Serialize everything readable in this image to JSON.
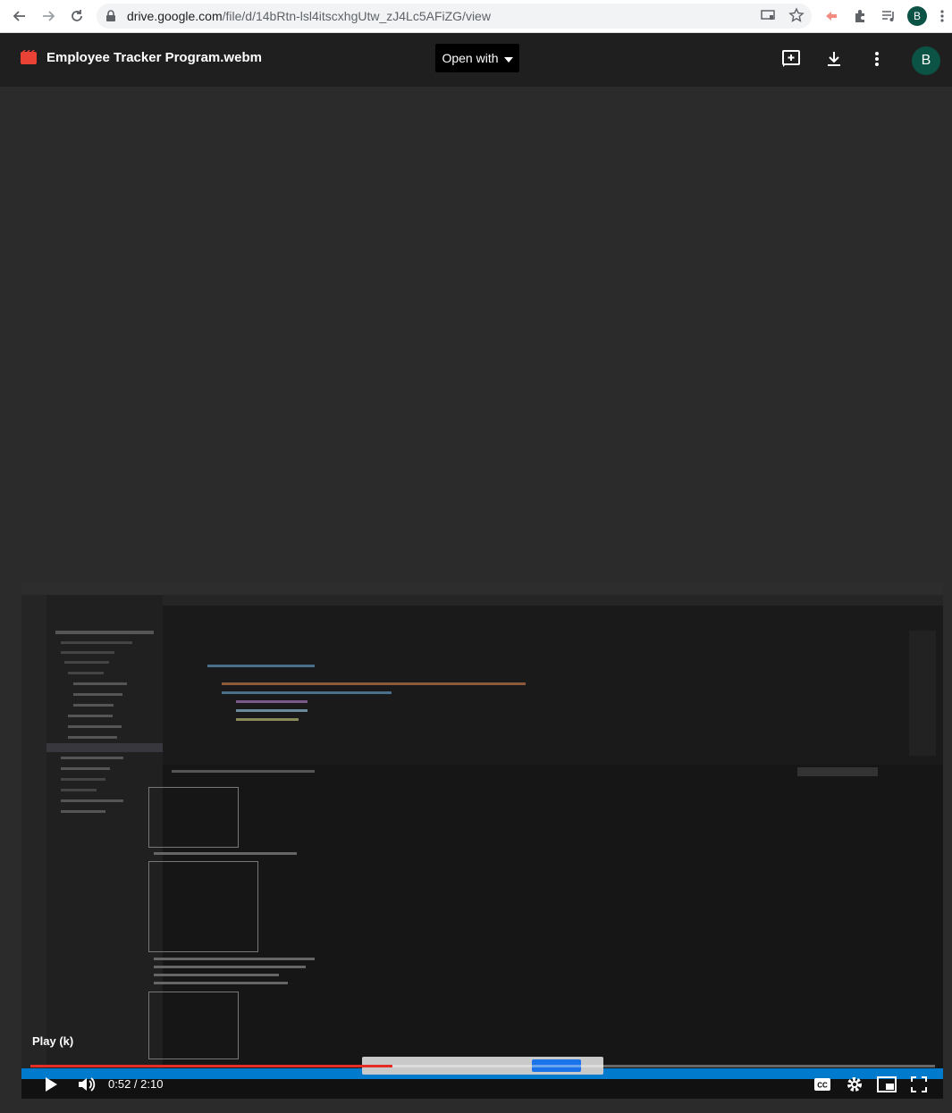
{
  "browser": {
    "url_host": "drive.google.com",
    "url_path": "/file/d/14bRtn-lsl4itscxhgUtw_zJ4Lc5AFiZG/view",
    "profile_initial": "B"
  },
  "viewer": {
    "file_name": "Employee Tracker Program.webm",
    "open_with_label": "Open with",
    "avatar_initial": "B"
  },
  "player": {
    "tooltip": "Play (k)",
    "time_display": "0:52 / 2:10",
    "progress_fraction": 0.4,
    "loaded_fraction": 0.4
  },
  "colors": {
    "accent_red": "#e52d27",
    "avatar_bg": "#0b5345",
    "viewer_bg": "#2b2b2b"
  },
  "icons": {
    "back": "arrow-left-icon",
    "forward": "arrow-right-icon",
    "reload": "reload-icon",
    "lock": "lock-icon",
    "cast": "cast-icon",
    "star": "star-icon",
    "extension_red": "extension-red-icon",
    "puzzle": "puzzle-icon",
    "media": "media-control-icon",
    "menu": "kebab-menu-icon",
    "add_comment": "add-comment-icon",
    "download": "download-icon",
    "more": "more-vert-icon",
    "play": "play-icon",
    "volume": "volume-icon",
    "cc": "closed-captions-icon",
    "settings": "settings-gear-icon",
    "miniplayer": "miniplayer-icon",
    "fullscreen": "fullscreen-icon"
  }
}
